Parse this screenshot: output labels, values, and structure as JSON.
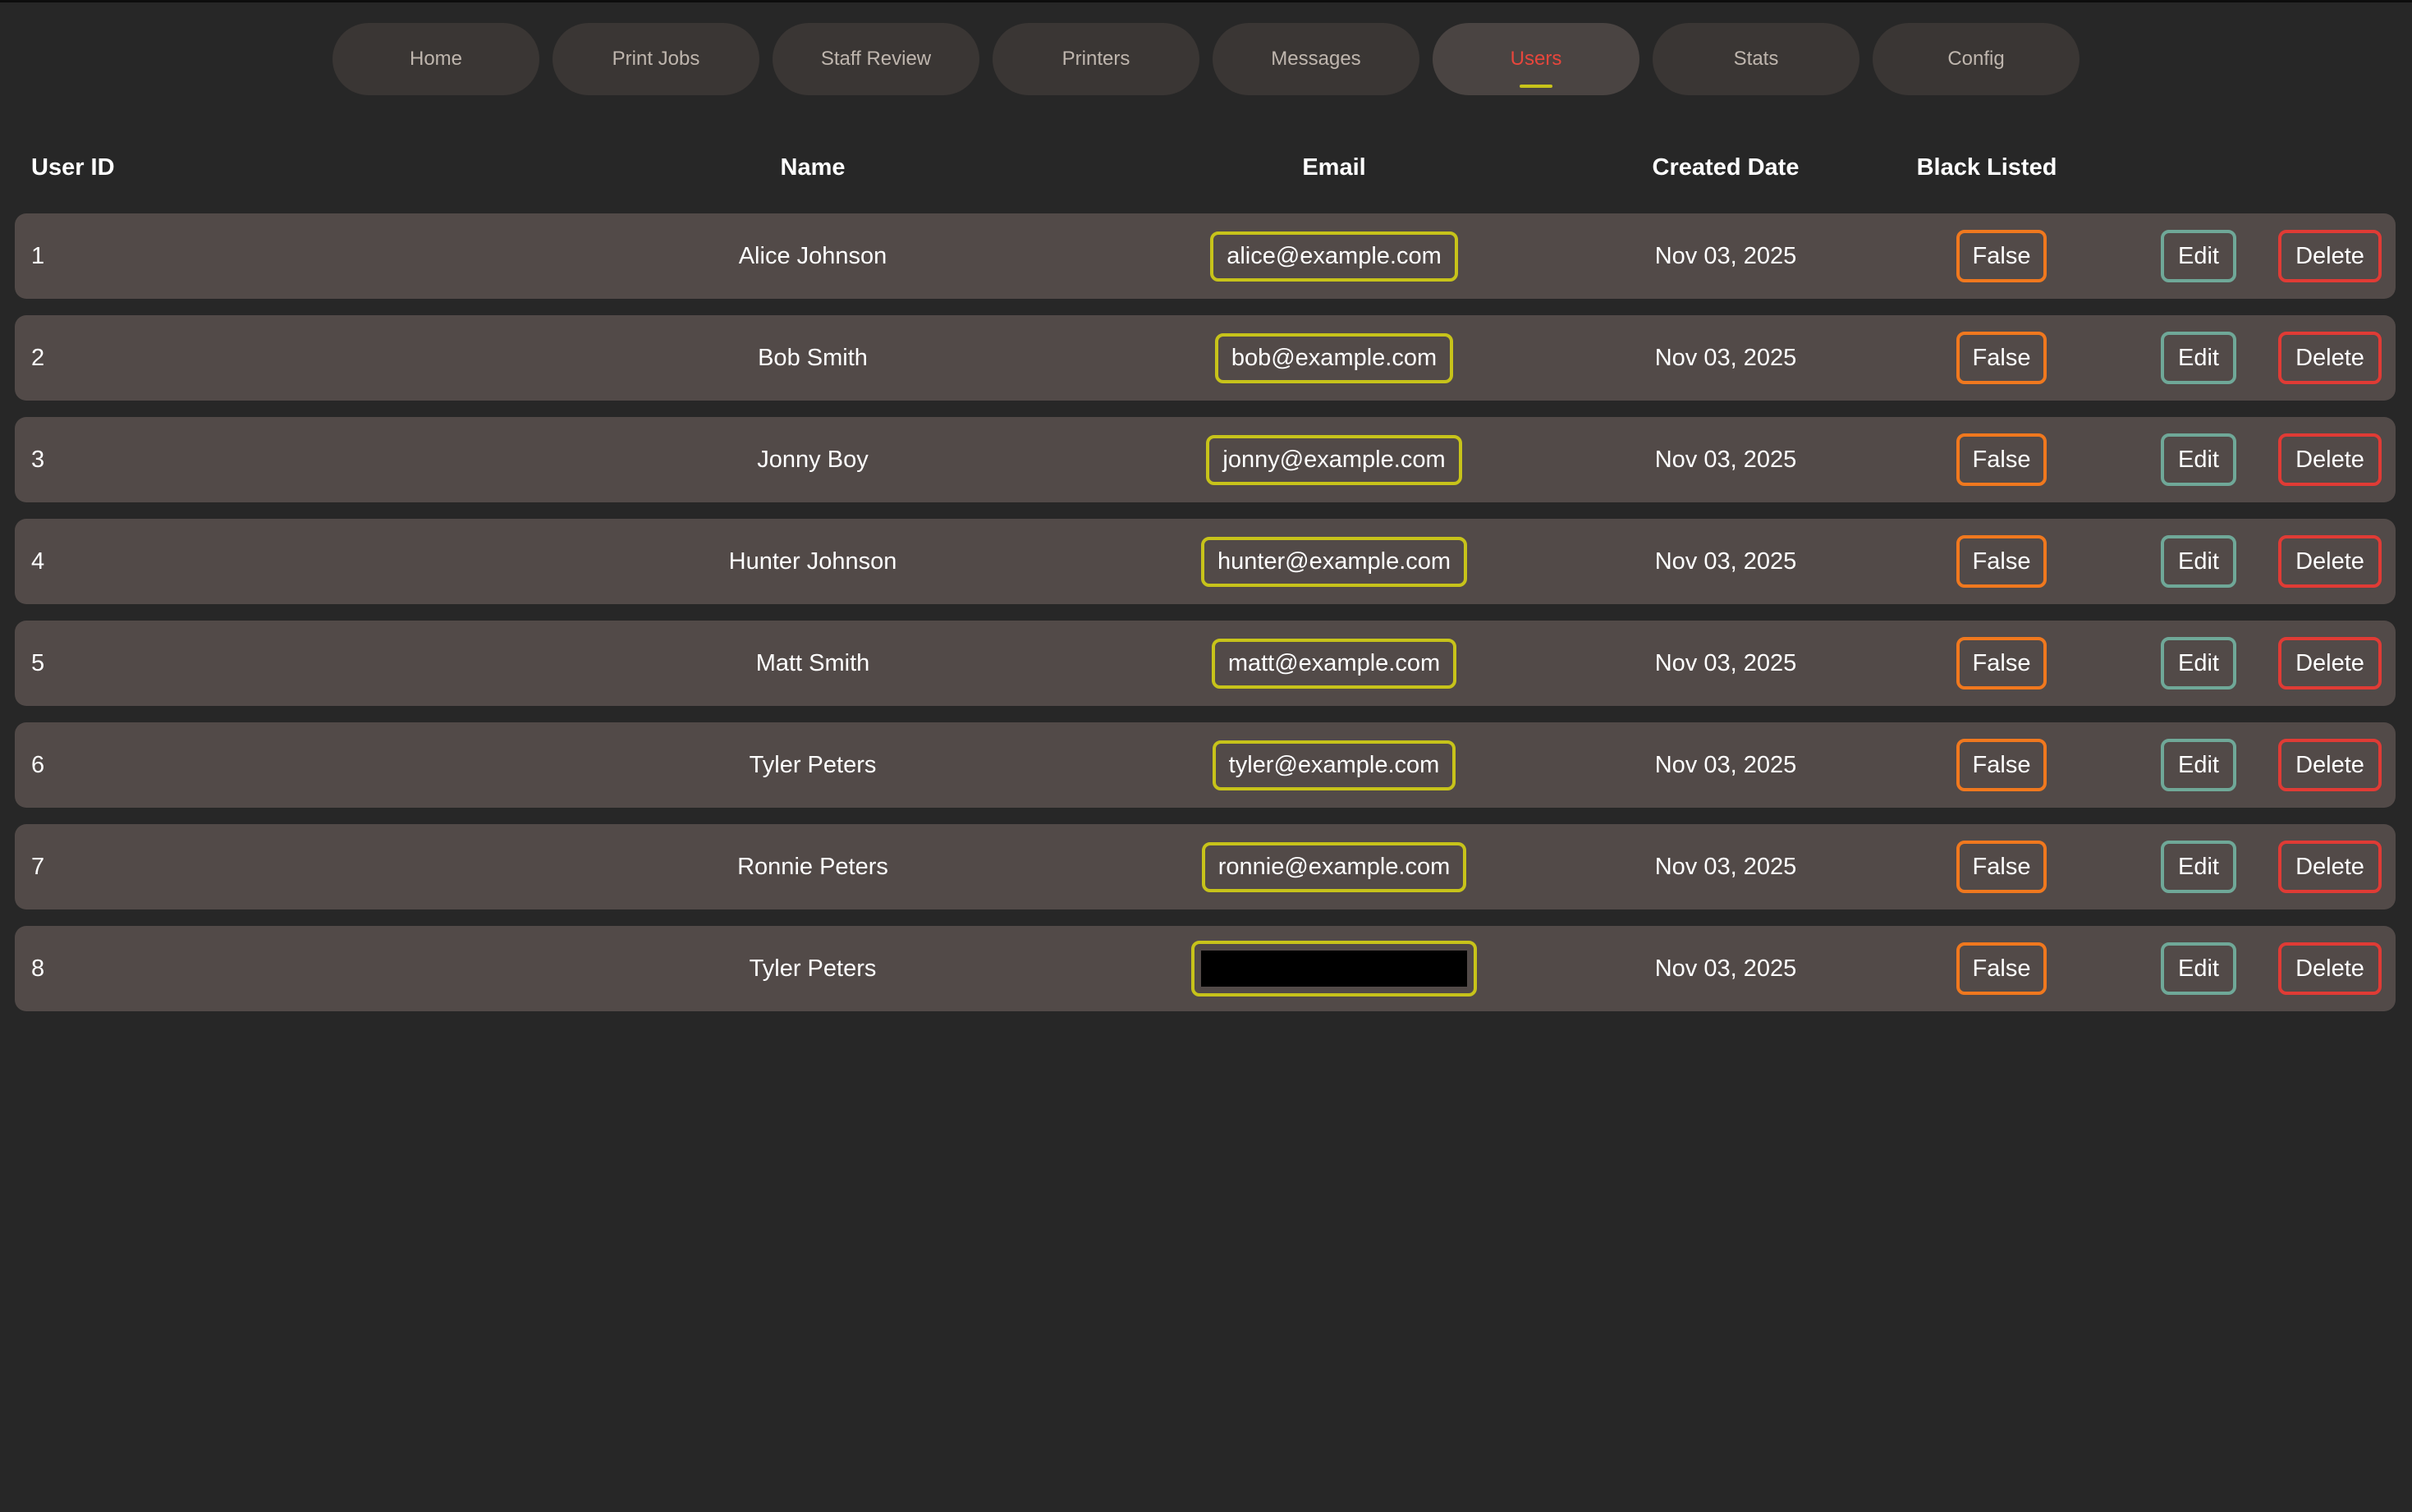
{
  "nav": {
    "tabs": [
      {
        "label": "Home",
        "active": false
      },
      {
        "label": "Print Jobs",
        "active": false
      },
      {
        "label": "Staff Review",
        "active": false
      },
      {
        "label": "Printers",
        "active": false
      },
      {
        "label": "Messages",
        "active": false
      },
      {
        "label": "Users",
        "active": true
      },
      {
        "label": "Stats",
        "active": false
      },
      {
        "label": "Config",
        "active": false
      }
    ]
  },
  "table": {
    "headers": {
      "user_id": "User ID",
      "name": "Name",
      "email": "Email",
      "created_date": "Created Date",
      "black_listed": "Black Listed"
    },
    "rows": [
      {
        "id": "1",
        "name": "Alice Johnson",
        "email": "alice@example.com",
        "created": "Nov 03, 2025",
        "black_listed": "False",
        "edit": "Edit",
        "delete": "Delete"
      },
      {
        "id": "2",
        "name": "Bob Smith",
        "email": "bob@example.com",
        "created": "Nov 03, 2025",
        "black_listed": "False",
        "edit": "Edit",
        "delete": "Delete"
      },
      {
        "id": "3",
        "name": "Jonny Boy",
        "email": "jonny@example.com",
        "created": "Nov 03, 2025",
        "black_listed": "False",
        "edit": "Edit",
        "delete": "Delete"
      },
      {
        "id": "4",
        "name": "Hunter Johnson",
        "email": "hunter@example.com",
        "created": "Nov 03, 2025",
        "black_listed": "False",
        "edit": "Edit",
        "delete": "Delete"
      },
      {
        "id": "5",
        "name": "Matt Smith",
        "email": "matt@example.com",
        "created": "Nov 03, 2025",
        "black_listed": "False",
        "edit": "Edit",
        "delete": "Delete"
      },
      {
        "id": "6",
        "name": "Tyler Peters",
        "email": "tyler@example.com",
        "created": "Nov 03, 2025",
        "black_listed": "False",
        "edit": "Edit",
        "delete": "Delete"
      },
      {
        "id": "7",
        "name": "Ronnie Peters",
        "email": "ronnie@example.com",
        "created": "Nov 03, 2025",
        "black_listed": "False",
        "edit": "Edit",
        "delete": "Delete"
      },
      {
        "id": "8",
        "name": "Tyler Peters",
        "email": "",
        "email_redacted": true,
        "created": "Nov 03, 2025",
        "black_listed": "False",
        "edit": "Edit",
        "delete": "Delete"
      }
    ]
  },
  "colors": {
    "background": "#272727",
    "row_bg": "#524a48",
    "tab_bg": "#3a3634",
    "active_tab_text": "#e8463c",
    "email_border": "#c7c31a",
    "blacklist_border": "#f0781e",
    "edit_border": "#6fa898",
    "delete_border": "#e03b35"
  }
}
